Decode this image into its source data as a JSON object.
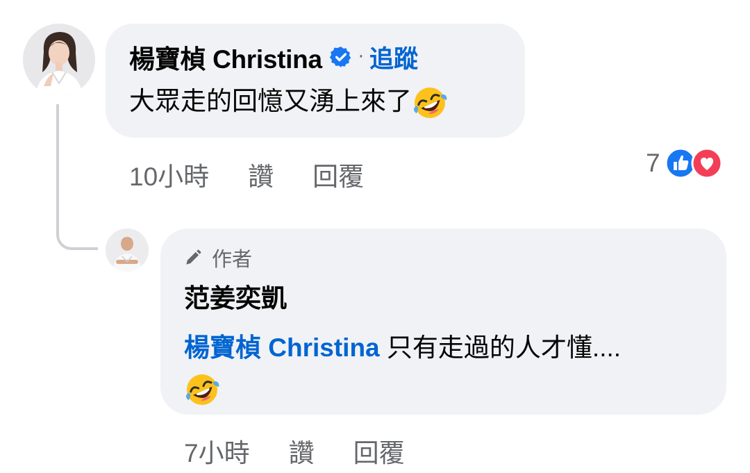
{
  "comment": {
    "author": "楊寶楨 Christina",
    "follow_label": "追蹤",
    "separator": "·",
    "text": "大眾走的回憶又湧上來了",
    "emoji": "rolling-on-floor-laughing",
    "time": "10小時",
    "like_label": "讚",
    "reply_label": "回覆",
    "reaction_count": "7",
    "reactions": [
      "like-icon",
      "love-icon"
    ]
  },
  "reply": {
    "badge": "作者",
    "author": "范姜奕凱",
    "mention": "楊寶楨 Christina",
    "text": "只有走過的人才懂....",
    "emoji": "rolling-on-floor-laughing",
    "time": "7小時",
    "like_label": "讚",
    "reply_label": "回覆"
  },
  "colors": {
    "bubble": "#f0f2f5",
    "link": "#0064d1",
    "secondary_text": "#65676b",
    "primary_text": "#050505",
    "like_blue": "#1877f2",
    "love_red": "#f33e58"
  }
}
